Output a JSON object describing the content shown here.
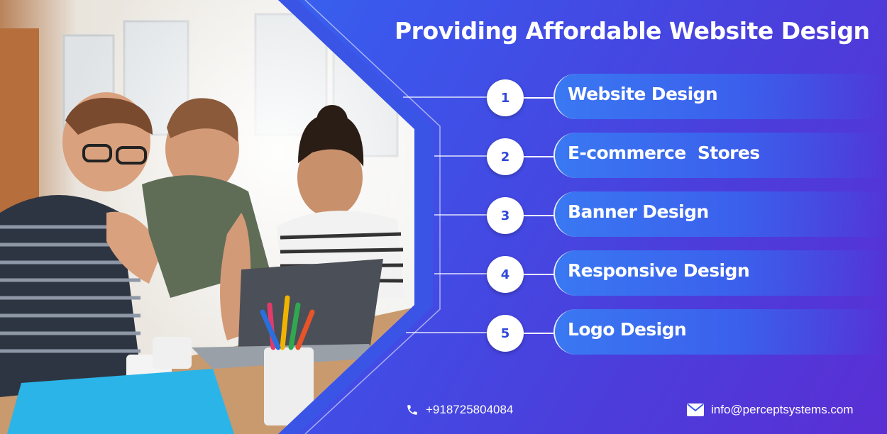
{
  "title": "Providing Affordable Website Design",
  "services": [
    {
      "number": "1",
      "label": "Website Design"
    },
    {
      "number": "2",
      "label": "E-commerce  Stores"
    },
    {
      "number": "3",
      "label": "Banner Design"
    },
    {
      "number": "4",
      "label": "Responsive Design"
    },
    {
      "number": "5",
      "label": "Logo Design"
    }
  ],
  "contact": {
    "phone": "+918725804084",
    "phone_icon": "phone-icon",
    "email": "info@perceptsystems.com",
    "email_icon": "envelope-icon"
  },
  "colors": {
    "background_start": "#2f7bf0",
    "background_end": "#5a2fd4",
    "number_text": "#3148d8",
    "text": "#ffffff"
  }
}
